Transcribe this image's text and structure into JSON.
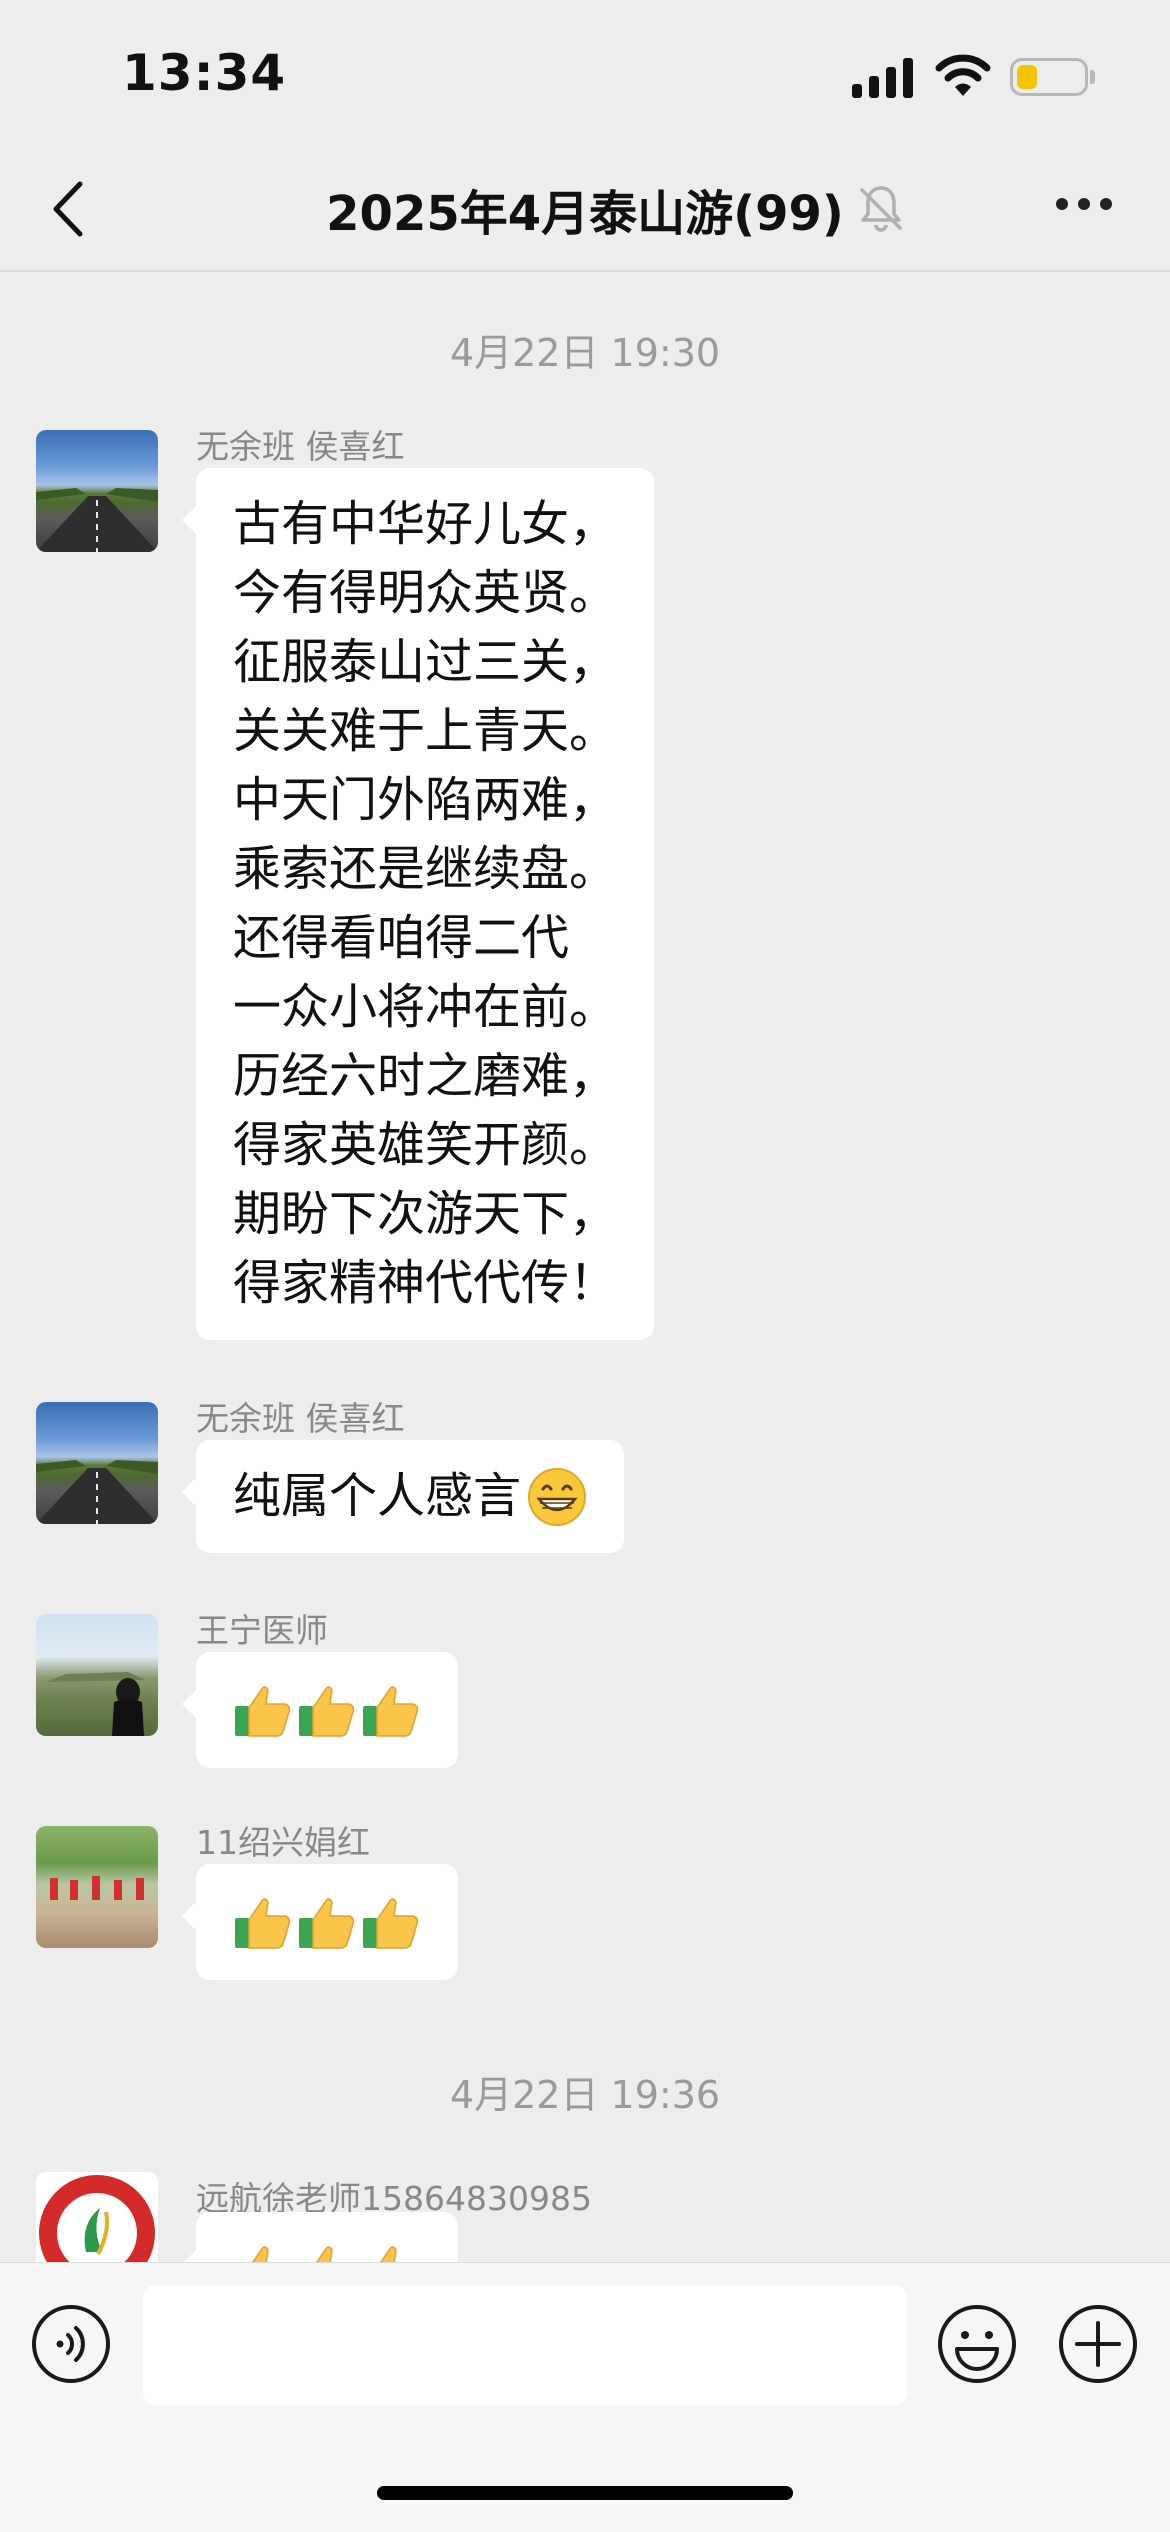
{
  "status_bar": {
    "time": "13:34",
    "battery_level": 0.3
  },
  "nav": {
    "title": "2025年4月泰山游(99)",
    "muted": true
  },
  "messages": {
    "ts1": "4月22日 19:30",
    "m1": {
      "sender": "无余班 侯喜红",
      "lines": [
        "古有中华好儿女，",
        "今有得明众英贤。",
        "征服泰山过三关，",
        "关关难于上青天。",
        "中天门外陷两难，",
        "乘索还是继续盘。",
        "还得看咱得二代",
        "一众小将冲在前。",
        "历经六时之磨难，",
        "得家英雄笑开颜。",
        "期盼下次游天下，",
        "得家精神代代传！"
      ]
    },
    "m2": {
      "sender": "无余班 侯喜红",
      "text": "纯属个人感言",
      "emoji": "grinning-face"
    },
    "m3": {
      "sender": "王宁医师",
      "content": "thumbs-up ×3"
    },
    "m4": {
      "sender": "11绍兴娟红",
      "content": "thumbs-up ×3"
    },
    "ts2": "4月22日 19:36",
    "m5": {
      "sender": "远航徐老师15864830985",
      "content": "thumbs-up ×3"
    }
  },
  "input": {
    "value": "",
    "placeholder": ""
  },
  "colors": {
    "background": "#ededed",
    "bubble": "#ffffff",
    "battery": "#f5c400",
    "timestamp": "#9a9a9a"
  }
}
